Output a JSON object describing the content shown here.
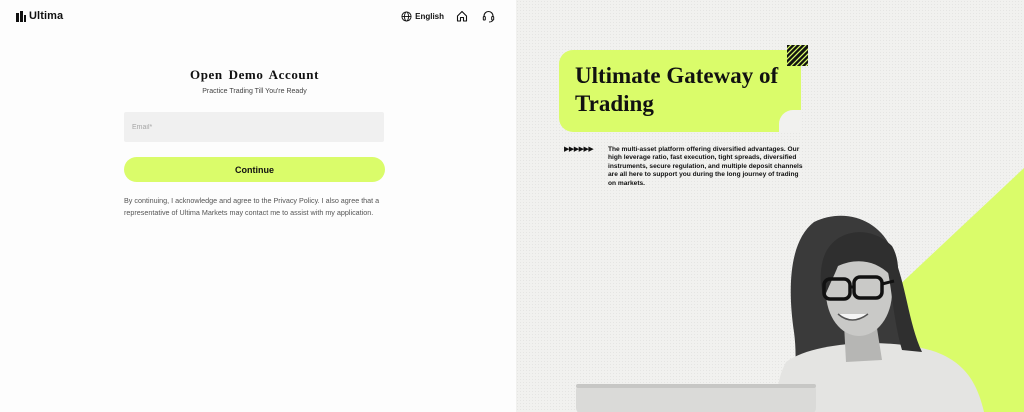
{
  "header": {
    "brand": "Ultima",
    "language": "English"
  },
  "form": {
    "title": "Open Demo Account",
    "subtitle": "Practice Trading Till You're Ready",
    "email_placeholder": "Email*",
    "email_value": "",
    "continue_label": "Continue",
    "legal_text": "By continuing, I acknowledge and agree to the Privacy Policy. I also agree that a representative of Ultima Markets may contact me to assist with my application."
  },
  "promo": {
    "headline": "Ultimate Gateway of Trading",
    "arrows": "▶▶▶▶▶▶",
    "description": "The multi-asset platform offering diversified advantages. Our high leverage ratio, fast execution, tight spreads, diversified instruments, secure regulation, and multiple deposit channels are all here to support you during the long journey of trading on markets."
  },
  "colors": {
    "accent": "#dafc6a",
    "text": "#111111",
    "input_bg": "#f0f0f0"
  },
  "icons": {
    "language": "globe-icon",
    "home": "home-icon",
    "support": "headset-icon"
  }
}
